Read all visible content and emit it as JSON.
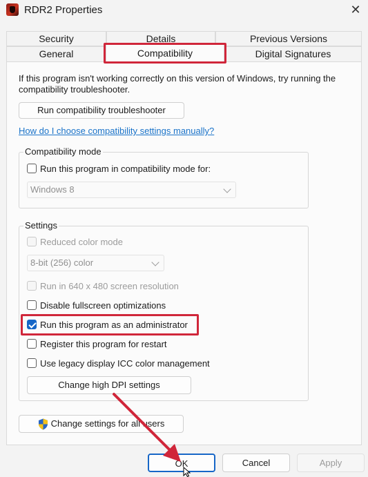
{
  "window": {
    "title": "RDR2 Properties",
    "close_glyph": "✕"
  },
  "tabs": {
    "row_back": [
      "Security",
      "Details",
      "Previous Versions"
    ],
    "row_front": [
      "General",
      "Compatibility",
      "Digital Signatures"
    ],
    "active": "Compatibility"
  },
  "intro_text": "If this program isn't working correctly on this version of Windows, try running the compatibility troubleshooter.",
  "troubleshooter_button": "Run compatibility troubleshooter",
  "help_link": "How do I choose compatibility settings manually?",
  "compat_mode": {
    "title": "Compatibility mode",
    "checkbox_label": "Run this program in compatibility mode for:",
    "checked": false,
    "os_select": "Windows 8"
  },
  "settings": {
    "title": "Settings",
    "reduced_color": {
      "label": "Reduced color mode",
      "checked": false,
      "enabled": false
    },
    "color_select": "8-bit (256) color",
    "res_640": {
      "label": "Run in 640 x 480 screen resolution",
      "checked": false,
      "enabled": false
    },
    "disable_fullscreen": {
      "label": "Disable fullscreen optimizations",
      "checked": false,
      "enabled": true
    },
    "run_as_admin": {
      "label": "Run this program as an administrator",
      "checked": true,
      "enabled": true
    },
    "register_restart": {
      "label": "Register this program for restart",
      "checked": false,
      "enabled": true
    },
    "legacy_icc": {
      "label": "Use legacy display ICC color management",
      "checked": false,
      "enabled": true
    },
    "dpi_button": "Change high DPI settings"
  },
  "all_users_button": "Change settings for all users",
  "footer": {
    "ok": "OK",
    "cancel": "Cancel",
    "apply": "Apply"
  },
  "colors": {
    "accent": "#1666c7",
    "highlight": "#d0263a",
    "link": "#1a73c9"
  }
}
